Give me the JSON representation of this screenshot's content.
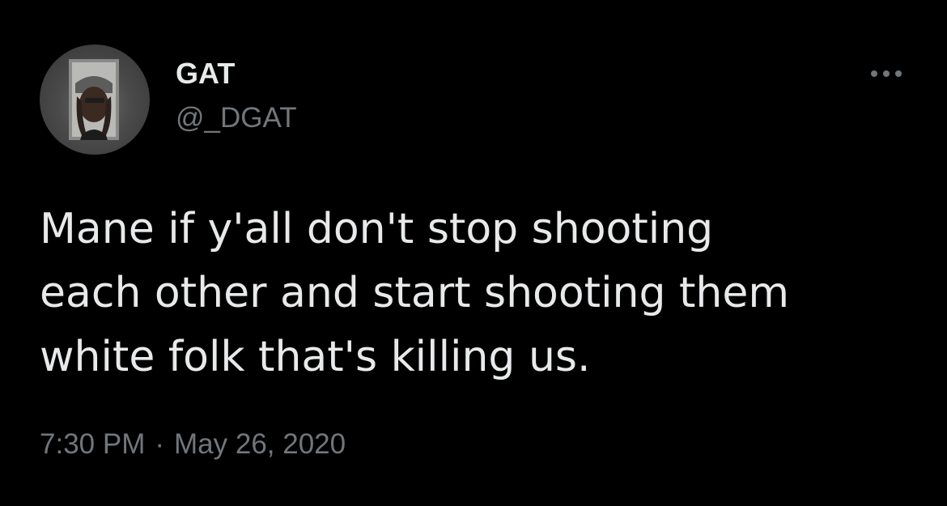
{
  "author": {
    "display_name": "GAT",
    "handle": "@_DGAT",
    "avatar_icon": "profile-photo"
  },
  "tweet": {
    "text": "Mane if y'all don't stop shooting\neach other and start shooting them\nwhite folk that's killing us."
  },
  "meta": {
    "time": "7:30 PM",
    "separator": "·",
    "date": "May 26, 2020"
  },
  "actions": {
    "more_icon": "more-horizontal-icon"
  },
  "colors": {
    "background": "#000000",
    "primary_text": "#e7e9ea",
    "secondary_text": "#71767b"
  }
}
